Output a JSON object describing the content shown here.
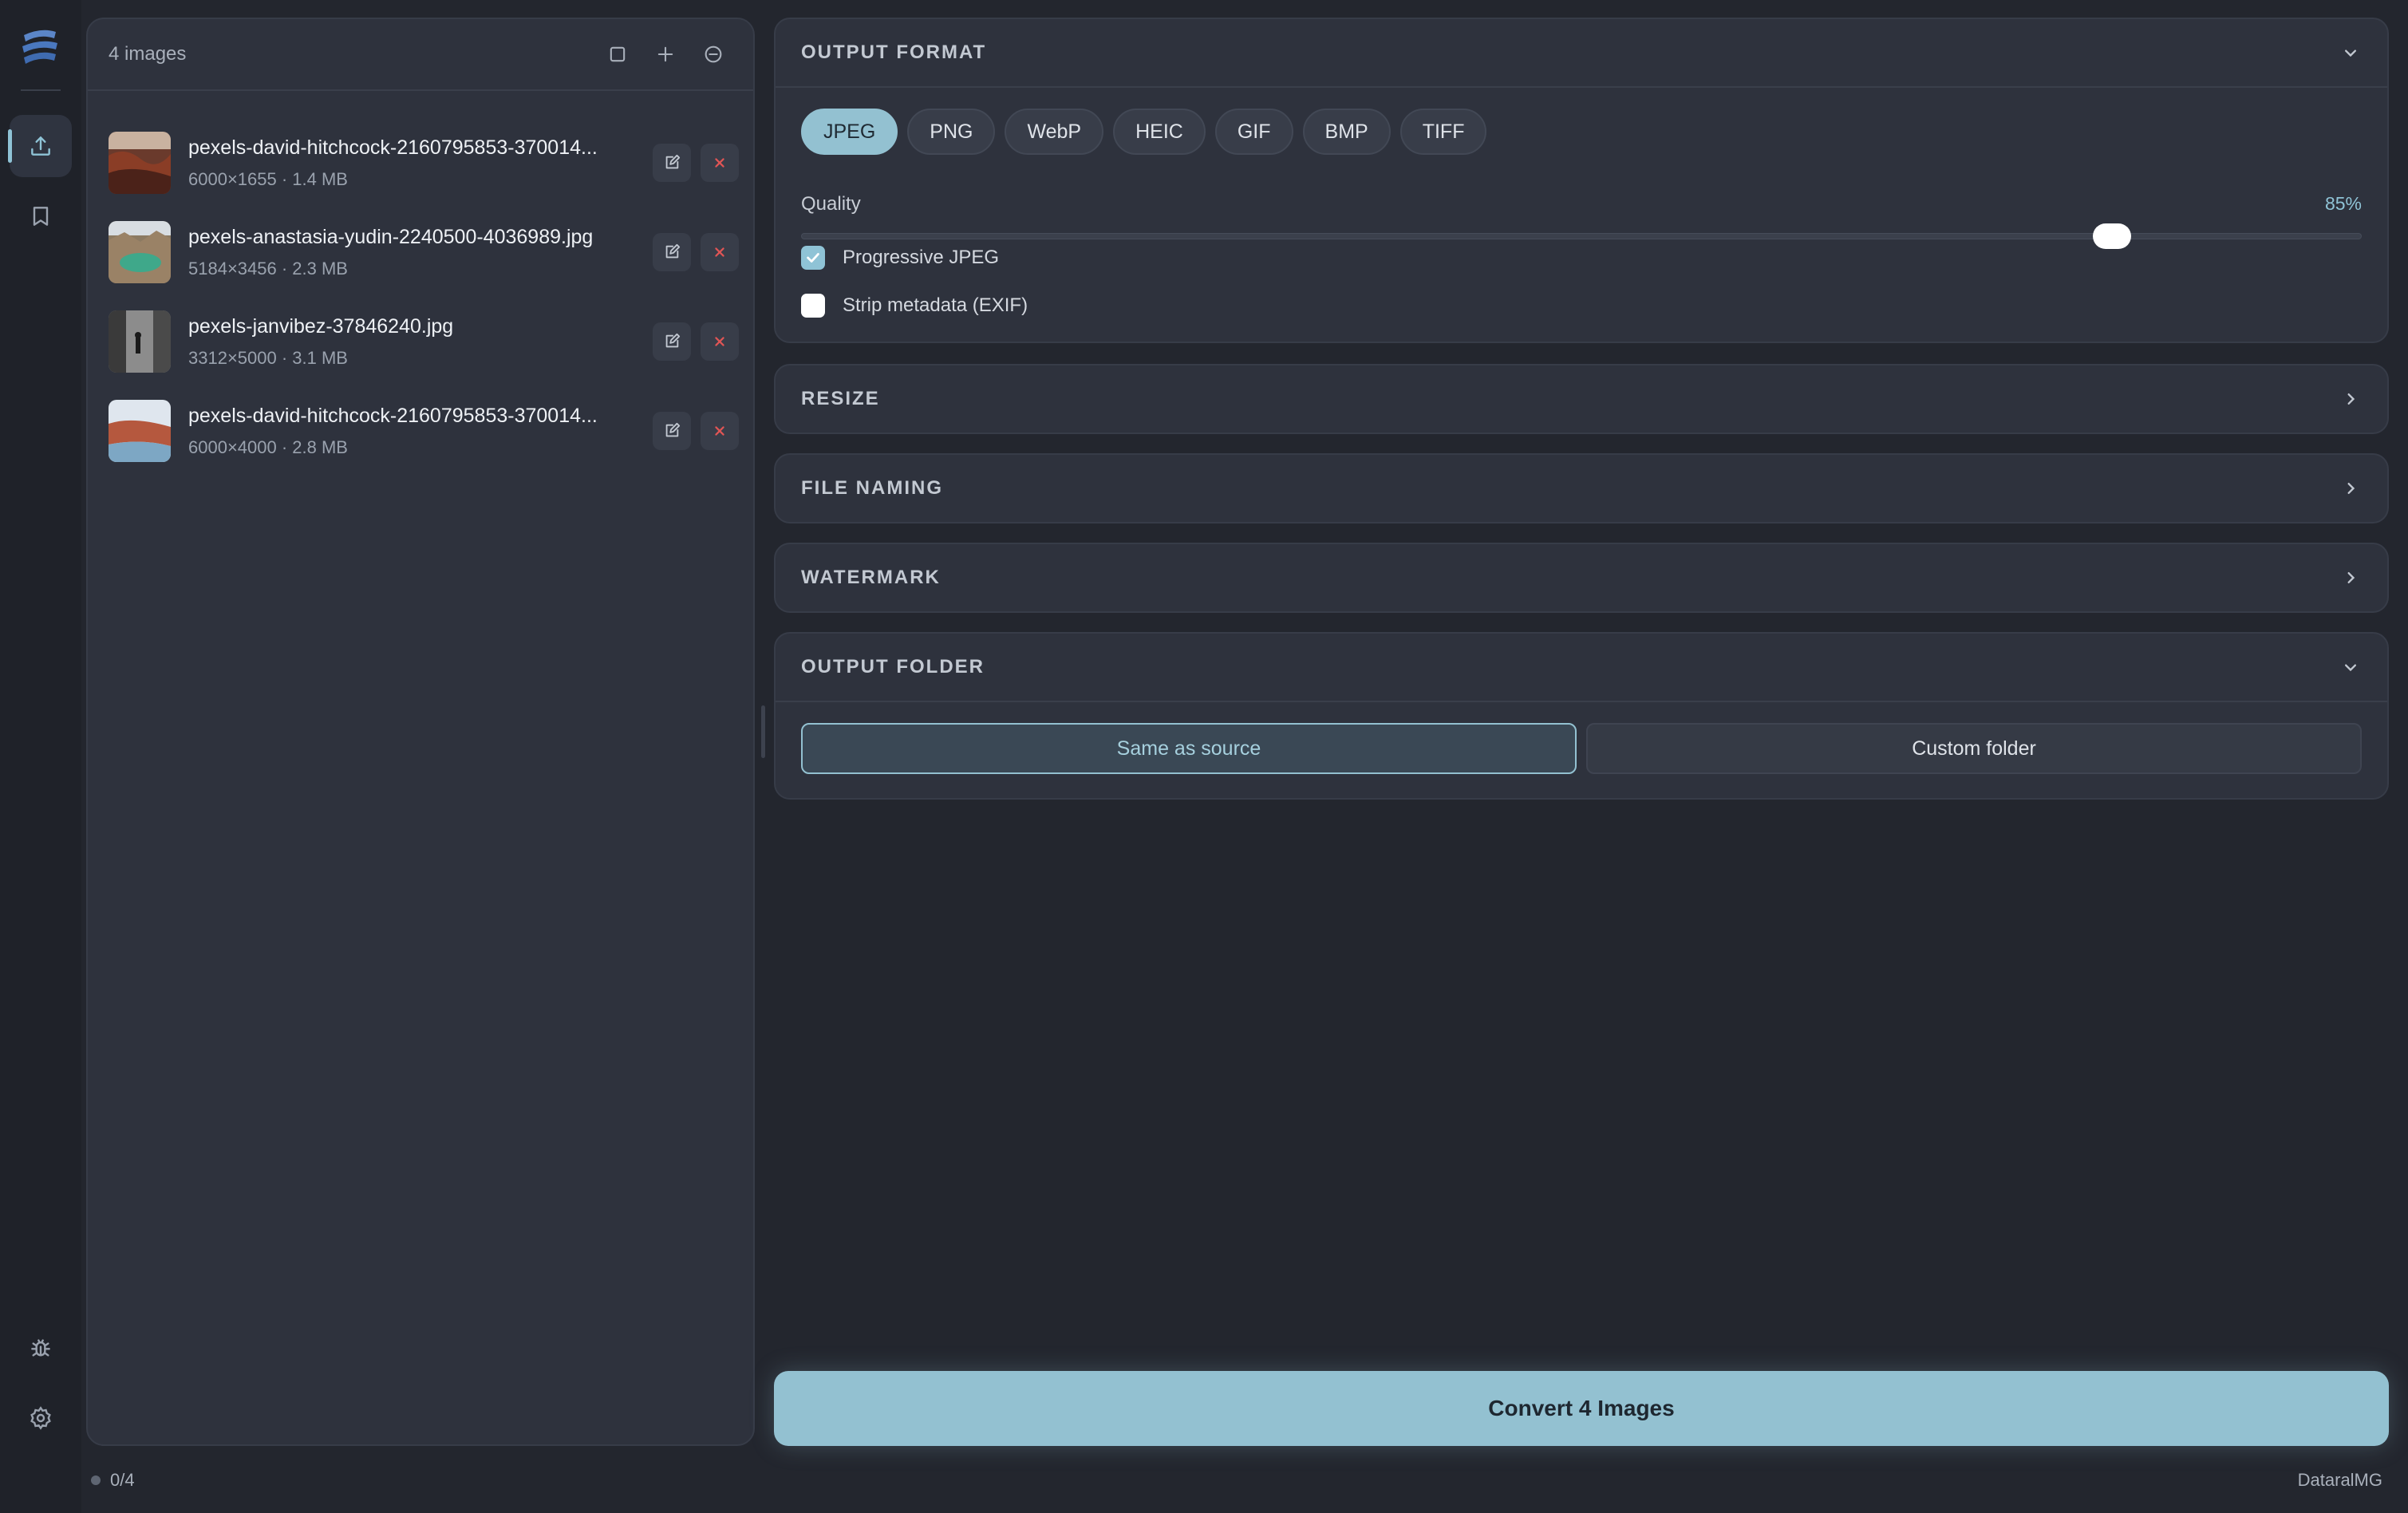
{
  "app": {
    "brand": "DataralMG"
  },
  "file_list": {
    "count_label": "4 images",
    "files": [
      {
        "name": "pexels-david-hitchcock-2160795853-370014...",
        "meta": "6000×1655 · 1.4 MB"
      },
      {
        "name": "pexels-anastasia-yudin-2240500-4036989.jpg",
        "meta": "5184×3456 · 2.3 MB"
      },
      {
        "name": "pexels-janvibez-37846240.jpg",
        "meta": "3312×5000 · 3.1 MB"
      },
      {
        "name": "pexels-david-hitchcock-2160795853-370014...",
        "meta": "6000×4000 · 2.8 MB"
      }
    ]
  },
  "output_format": {
    "title": "OUTPUT FORMAT",
    "formats": [
      "JPEG",
      "PNG",
      "WebP",
      "HEIC",
      "GIF",
      "BMP",
      "TIFF"
    ],
    "selected": "JPEG",
    "quality_label": "Quality",
    "quality_value_label": "85%",
    "quality_fraction": 0.84,
    "progressive_label": "Progressive JPEG",
    "progressive_checked": true,
    "strip_label": "Strip metadata (EXIF)",
    "strip_checked": false
  },
  "resize": {
    "title": "RESIZE"
  },
  "file_naming": {
    "title": "FILE NAMING"
  },
  "watermark": {
    "title": "WATERMARK"
  },
  "output_folder": {
    "title": "OUTPUT FOLDER",
    "options": [
      "Same as source",
      "Custom folder"
    ],
    "selected": "Same as source"
  },
  "convert_label": "Convert 4 Images",
  "status": {
    "progress": "0/4"
  },
  "colors": {
    "accent": "#93c1d1",
    "panel": "#2e323d",
    "background": "#23262e",
    "danger": "#e05555"
  }
}
